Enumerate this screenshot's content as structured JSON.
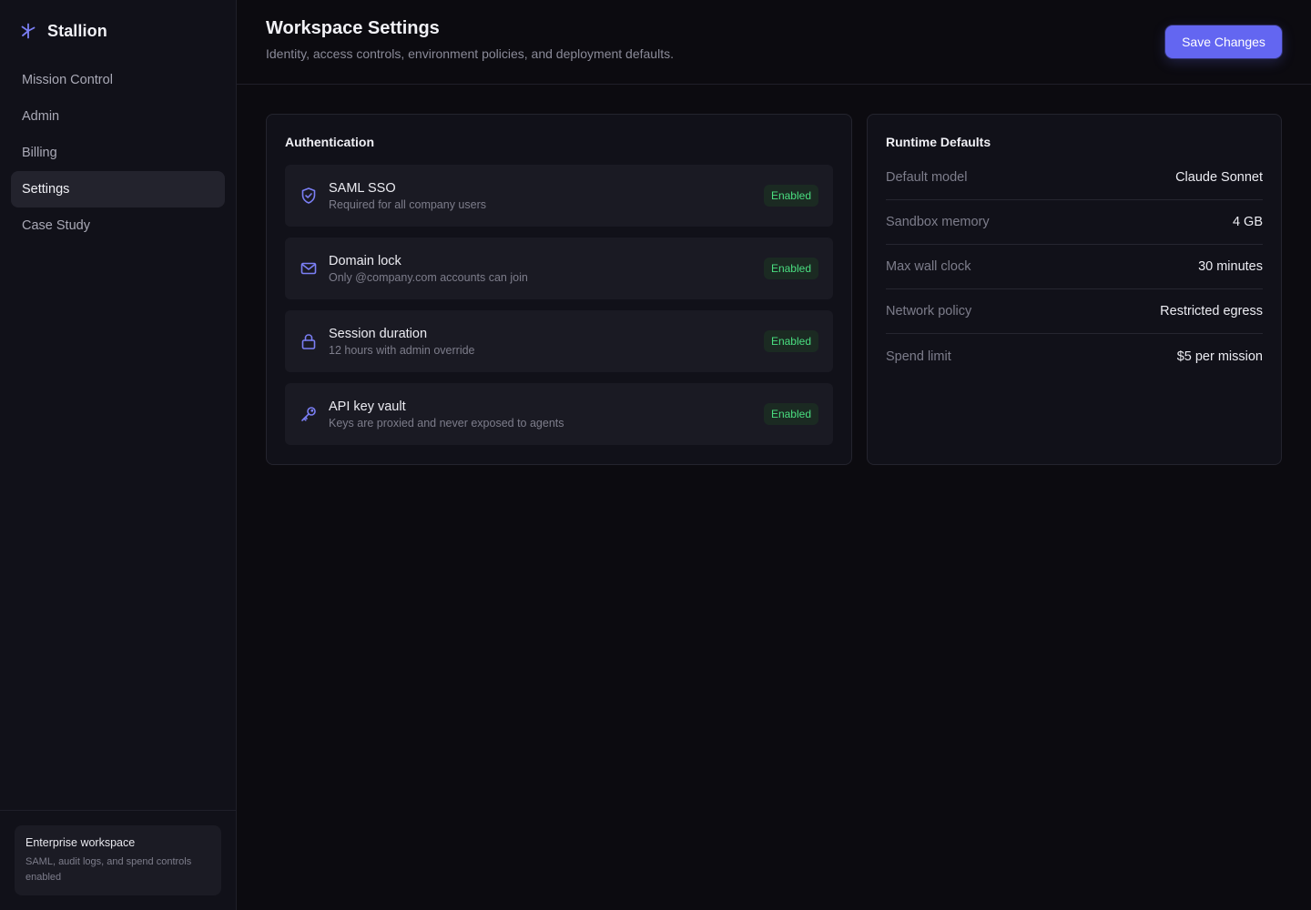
{
  "brand": {
    "name": "Stallion",
    "icon": "sparkle-icon",
    "accent": "#6366f1"
  },
  "sidebar": {
    "items": [
      {
        "label": "Mission Control",
        "active": false
      },
      {
        "label": "Admin",
        "active": false
      },
      {
        "label": "Billing",
        "active": false
      },
      {
        "label": "Settings",
        "active": true
      },
      {
        "label": "Case Study",
        "active": false
      }
    ],
    "footer": {
      "title": "Enterprise workspace",
      "description": "SAML, audit logs, and spend controls enabled"
    }
  },
  "header": {
    "title": "Workspace Settings",
    "subtitle": "Identity, access controls, environment policies, and deployment defaults.",
    "save_label": "Save Changes"
  },
  "authentication": {
    "title": "Authentication",
    "items": [
      {
        "icon": "shield-check-icon",
        "name": "SAML SSO",
        "description": "Required for all company users",
        "status": "Enabled"
      },
      {
        "icon": "mail-icon",
        "name": "Domain lock",
        "description": "Only @company.com accounts can join",
        "status": "Enabled"
      },
      {
        "icon": "lock-icon",
        "name": "Session duration",
        "description": "12 hours with admin override",
        "status": "Enabled"
      },
      {
        "icon": "key-icon",
        "name": "API key vault",
        "description": "Keys are proxied and never exposed to agents",
        "status": "Enabled"
      }
    ],
    "status_color": "#4ade80"
  },
  "runtime": {
    "title": "Runtime Defaults",
    "rows": [
      {
        "label": "Default model",
        "value": "Claude Sonnet"
      },
      {
        "label": "Sandbox memory",
        "value": "4 GB"
      },
      {
        "label": "Max wall clock",
        "value": "30 minutes"
      },
      {
        "label": "Network policy",
        "value": "Restricted egress"
      },
      {
        "label": "Spend limit",
        "value": "$5 per mission"
      }
    ]
  }
}
